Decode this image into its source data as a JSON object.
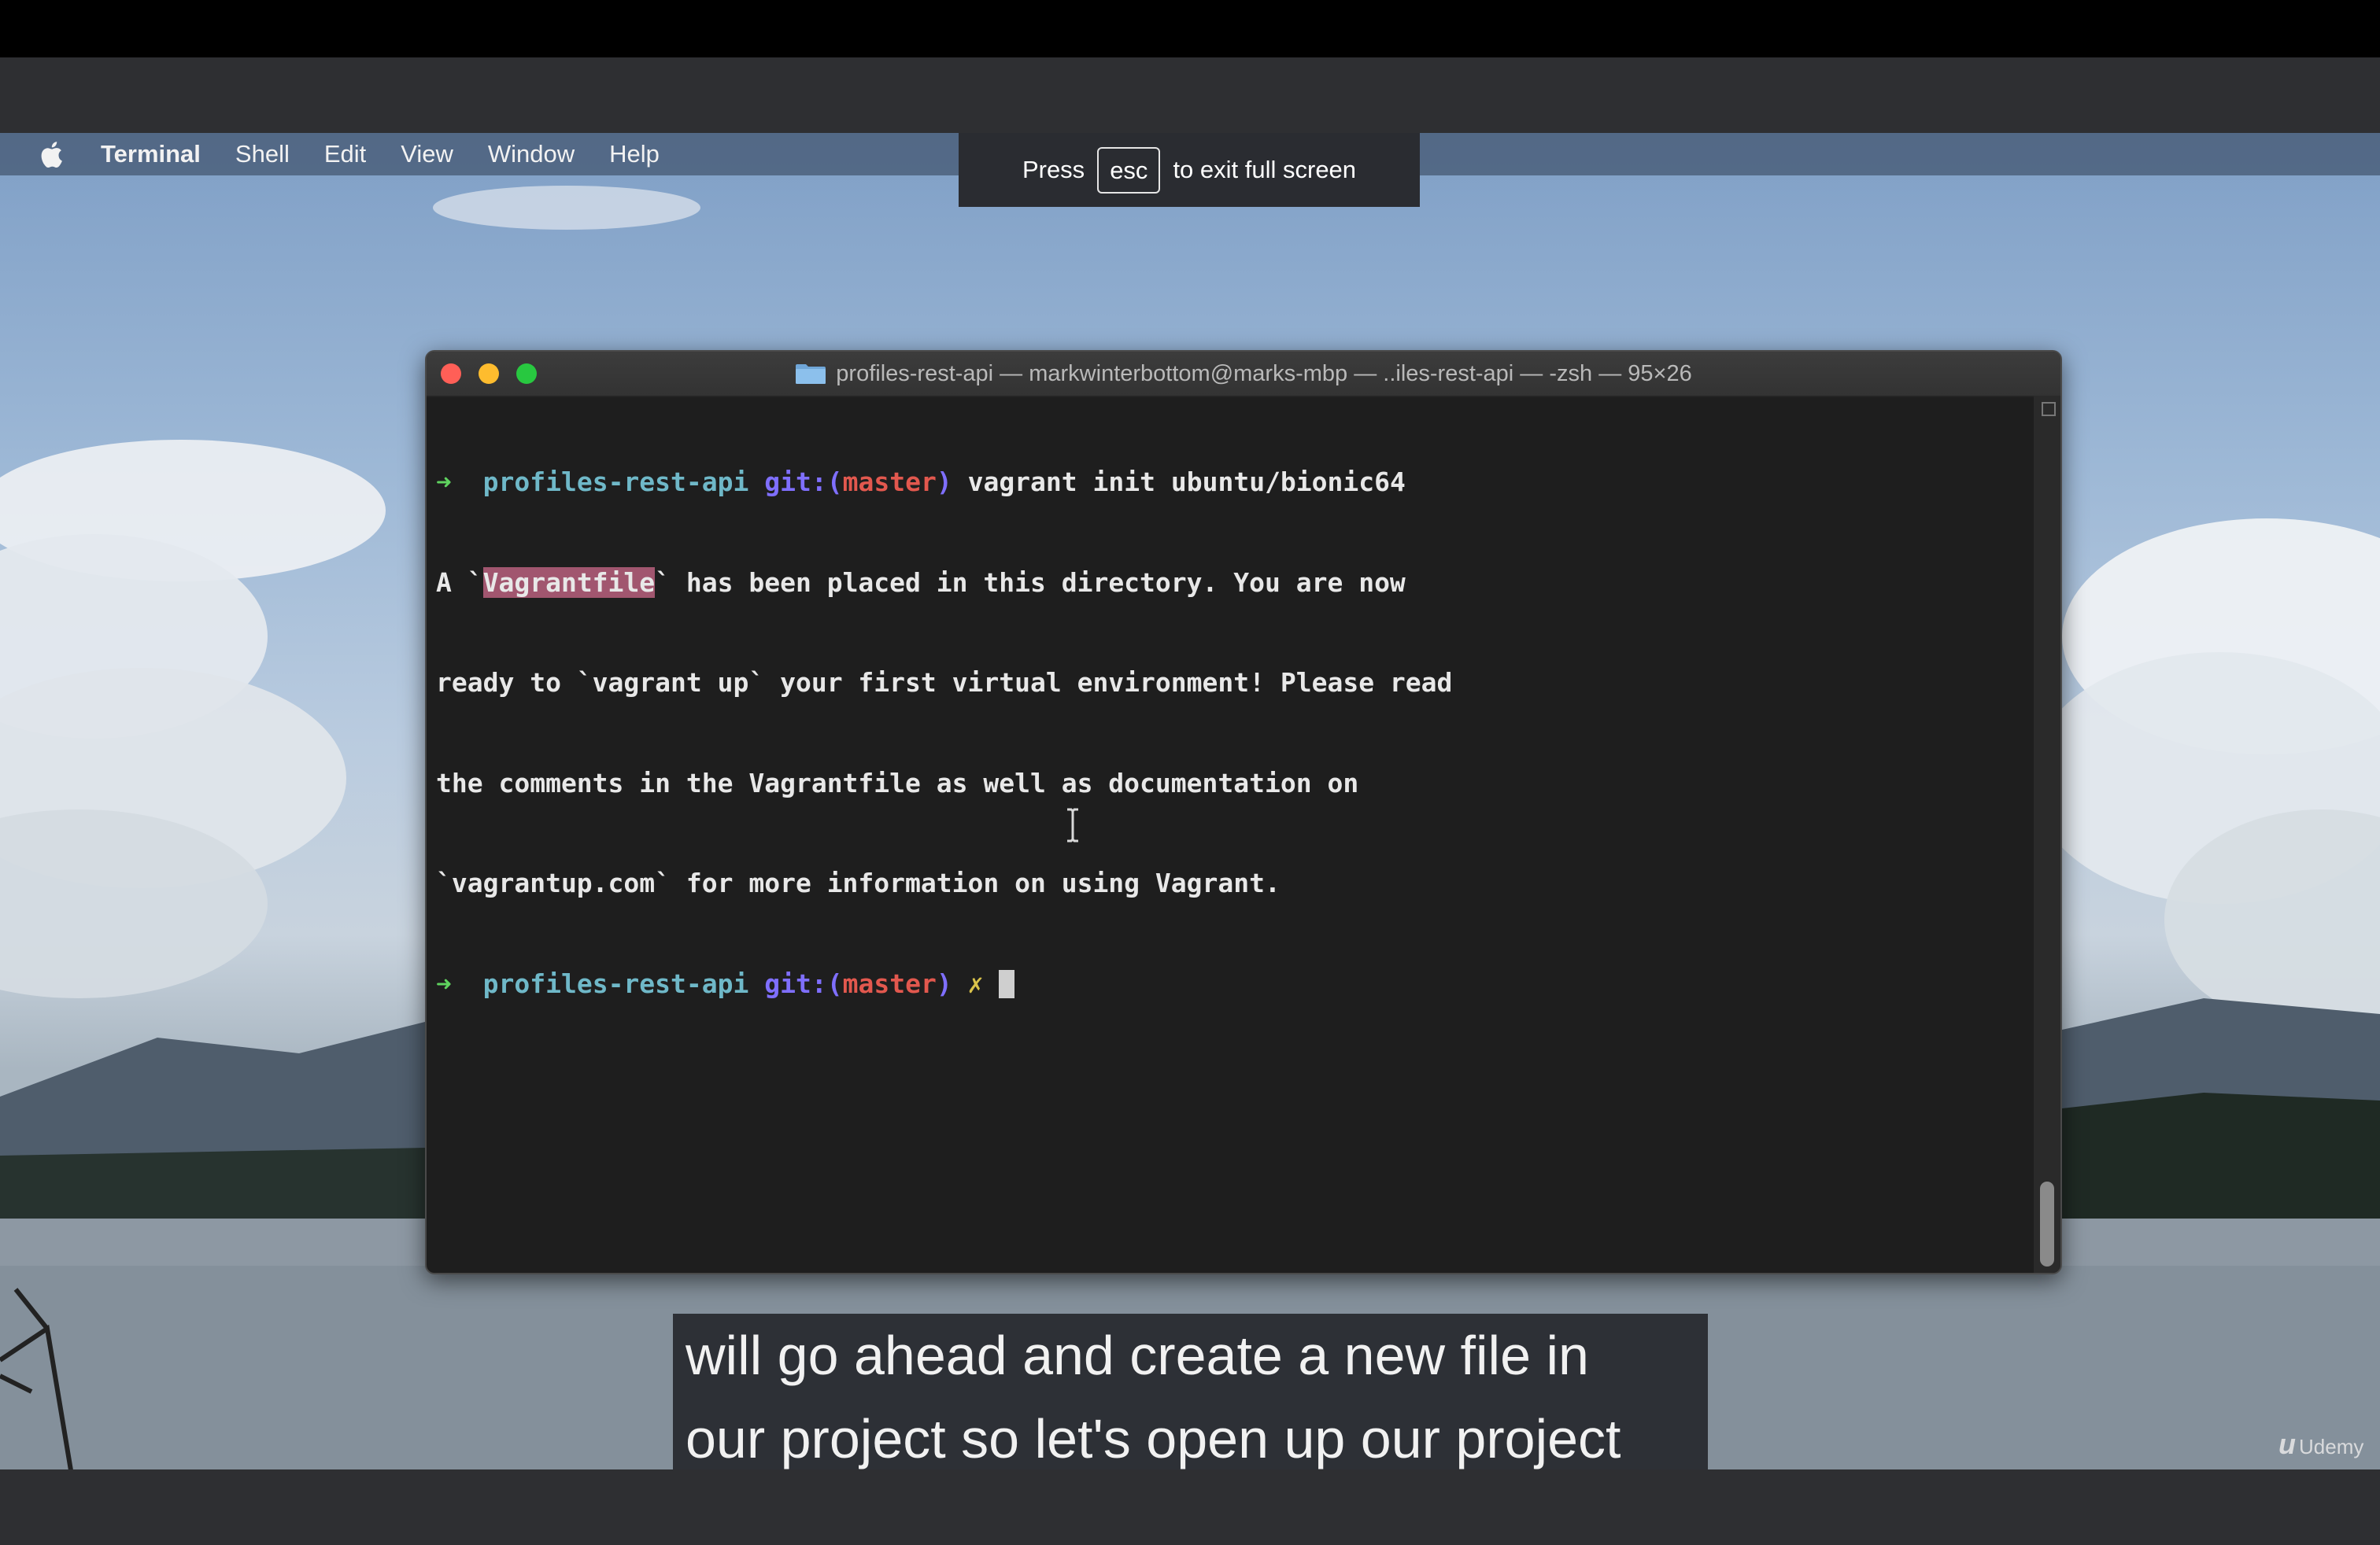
{
  "menubar": {
    "items": [
      "Terminal",
      "Shell",
      "Edit",
      "View",
      "Window",
      "Help"
    ]
  },
  "fullscreen_notice": {
    "before": "Press",
    "key": "esc",
    "after": "to exit full screen"
  },
  "terminal": {
    "title": "profiles-rest-api — markwinterbottom@marks-mbp — ..iles-rest-api — -zsh — 95×26",
    "prompt": {
      "arrow": "➜",
      "dir": "profiles-rest-api",
      "git": "git:(",
      "branch": "master",
      "git_close": ")",
      "dirty": "✗"
    },
    "command": "vagrant init ubuntu/bionic64",
    "output": {
      "line1_a": "A `",
      "line1_sel": "Vagrantfile",
      "line1_b": "` has been placed in this directory. You are now",
      "line2": "ready to `vagrant up` your first virtual environment! Please read",
      "line3": "the comments in the Vagrantfile as well as documentation on",
      "line4": "`vagrantup.com` for more information on using Vagrant."
    }
  },
  "caption": {
    "line1": "will go ahead and create a new file in",
    "line2": "our project so let's open up our project"
  },
  "watermark": {
    "mark": "u",
    "label": "Udemy"
  },
  "colors": {
    "prompt_arrow": "#5fd35f",
    "prompt_dir": "#6fb8c8",
    "prompt_git": "#7f6fff",
    "prompt_branch": "#e2584e",
    "selection": "#a1566f"
  }
}
